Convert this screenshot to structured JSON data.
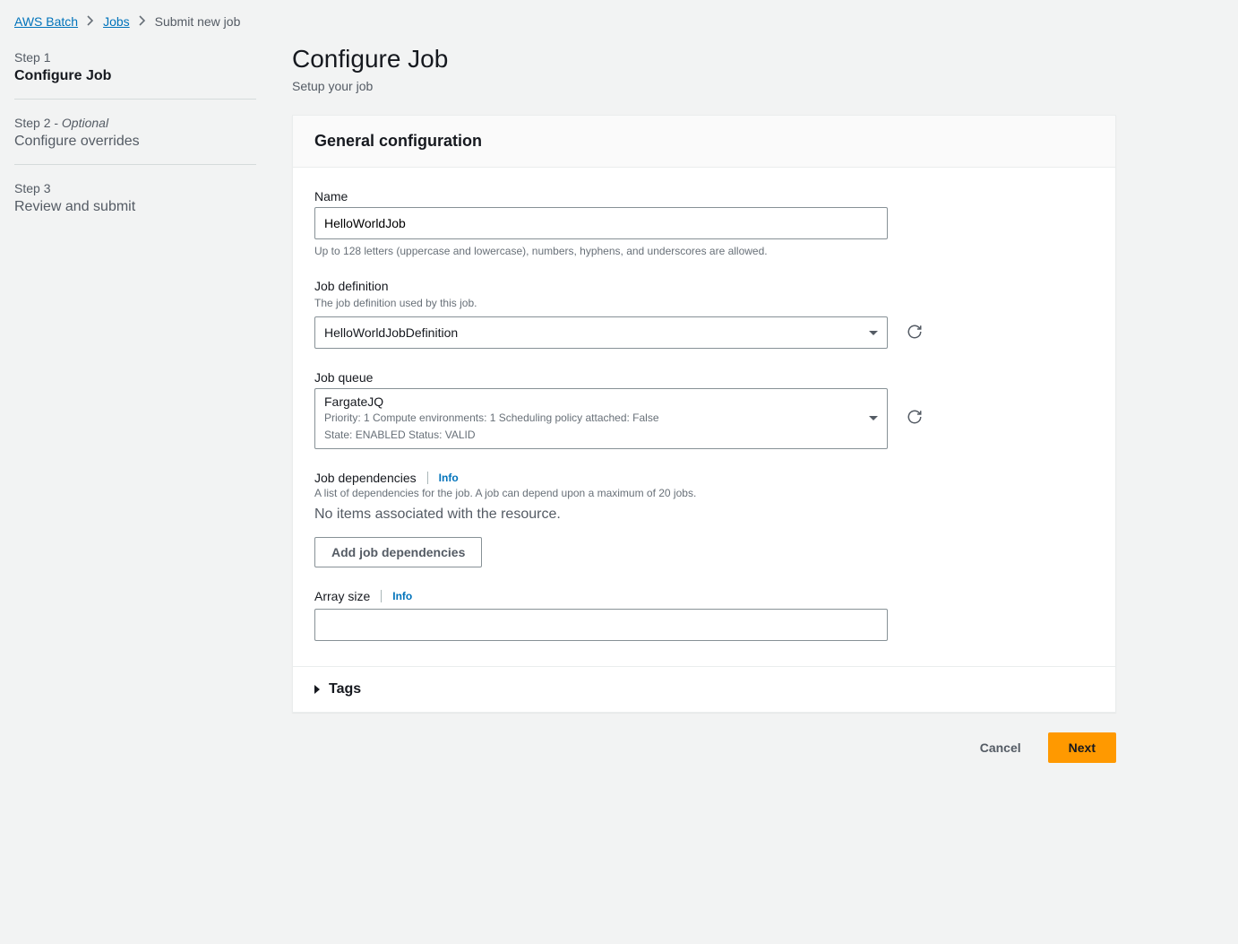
{
  "breadcrumb": {
    "root": "AWS Batch",
    "mid": "Jobs",
    "current": "Submit new job"
  },
  "sidebar": {
    "steps": [
      {
        "label": "Step 1",
        "optional": "",
        "title": "Configure Job",
        "active": true
      },
      {
        "label": "Step 2 - ",
        "optional": "Optional",
        "title": "Configure overrides",
        "active": false
      },
      {
        "label": "Step 3",
        "optional": "",
        "title": "Review and submit",
        "active": false
      }
    ]
  },
  "page": {
    "title": "Configure Job",
    "subtitle": "Setup your job"
  },
  "general": {
    "header": "General configuration",
    "name": {
      "label": "Name",
      "value": "HelloWorldJob",
      "hint": "Up to 128 letters (uppercase and lowercase), numbers, hyphens, and underscores are allowed."
    },
    "jobDefinition": {
      "label": "Job definition",
      "sublabel": "The job definition used by this job.",
      "value": "HelloWorldJobDefinition"
    },
    "jobQueue": {
      "label": "Job queue",
      "value": "FargateJQ",
      "meta1": "Priority: 1     Compute environments: 1     Scheduling policy attached: False",
      "meta2": "State: ENABLED     Status: VALID"
    },
    "dependencies": {
      "label": "Job dependencies",
      "info": "Info",
      "sublabel": "A list of dependencies for the job. A job can depend upon a maximum of 20 jobs.",
      "empty": "No items associated with the resource.",
      "addButton": "Add job dependencies"
    },
    "arraySize": {
      "label": "Array size",
      "info": "Info",
      "value": ""
    },
    "tags": {
      "label": "Tags"
    }
  },
  "footer": {
    "cancel": "Cancel",
    "next": "Next"
  }
}
